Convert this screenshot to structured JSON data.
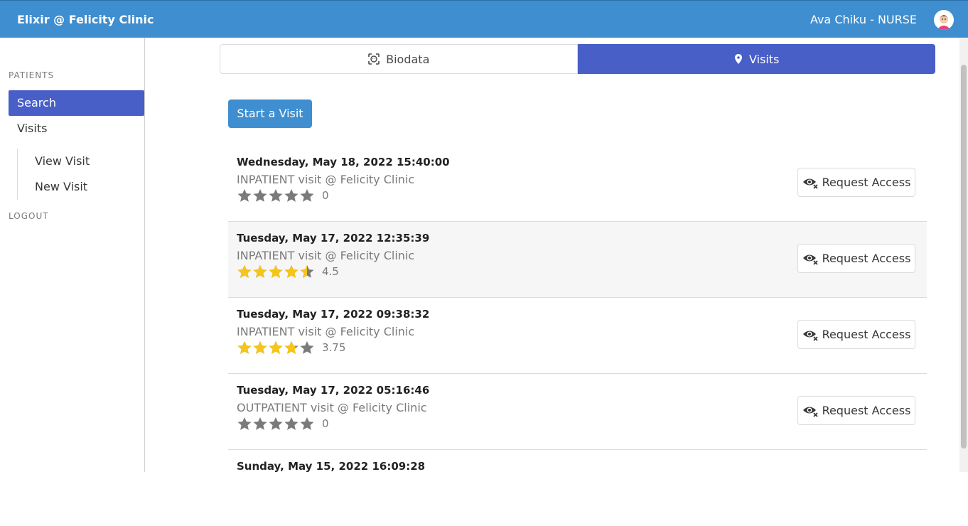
{
  "header": {
    "brand": "Elixir @ Felicity Clinic",
    "user": "Ava Chiku - NURSE"
  },
  "sidebar": {
    "section_label": "PATIENTS",
    "items": [
      {
        "label": "Search"
      },
      {
        "label": "Visits"
      }
    ],
    "sub_items": [
      {
        "label": "View Visit"
      },
      {
        "label": "New Visit"
      }
    ],
    "logout_label": "LOGOUT"
  },
  "tabs": {
    "biodata": "Biodata",
    "visits": "Visits"
  },
  "start_visit_label": "Start a Visit",
  "visits": [
    {
      "date": "Wednesday, May 18, 2022 15:40:00",
      "type": "INPATIENT visit @ Felicity Clinic",
      "rating": 0,
      "rating_label": "0",
      "action": "Request Access"
    },
    {
      "date": "Tuesday, May 17, 2022 12:35:39",
      "type": "INPATIENT visit @ Felicity Clinic",
      "rating": 4.5,
      "rating_label": "4.5",
      "action": "Request Access"
    },
    {
      "date": "Tuesday, May 17, 2022 09:38:32",
      "type": "INPATIENT visit @ Felicity Clinic",
      "rating": 3.75,
      "rating_label": "3.75",
      "action": "Request Access"
    },
    {
      "date": "Tuesday, May 17, 2022 05:16:46",
      "type": "OUTPATIENT visit @ Felicity Clinic",
      "rating": 0,
      "rating_label": "0",
      "action": "Request Access"
    },
    {
      "date": "Sunday, May 15, 2022 16:09:28",
      "type": "",
      "rating": null,
      "rating_label": "",
      "action": ""
    }
  ],
  "colors": {
    "navbar": "#3e8ed0",
    "active": "#485fc7",
    "star_filled": "#f5c518",
    "star_empty": "#7a7a7a"
  }
}
